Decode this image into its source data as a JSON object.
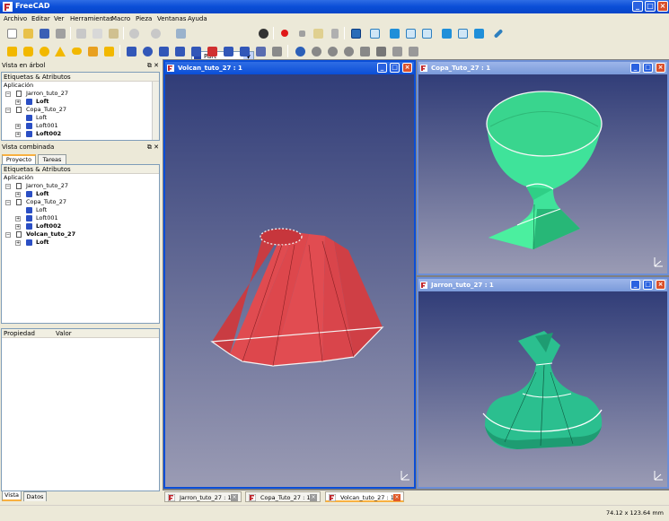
{
  "window": {
    "title": "FreeCAD"
  },
  "menu": [
    "Archivo",
    "Editar",
    "Ver",
    "Herramientas",
    "Macro",
    "Pieza",
    "Ventanas",
    "Ayuda"
  ],
  "workbench": {
    "selected": "Part"
  },
  "tree_dock": {
    "title": "Vista en árbol",
    "header": "Etiquetas & Atributos",
    "root": "Aplicación",
    "items": [
      {
        "label": "Jarron_tuto_27",
        "kind": "doc",
        "bold": false
      },
      {
        "label": "Loft",
        "kind": "part",
        "bold": true
      },
      {
        "label": "Copa_Tuto_27",
        "kind": "doc",
        "bold": false
      },
      {
        "label": "Loft",
        "kind": "part",
        "bold": false
      },
      {
        "label": "Loft001",
        "kind": "part",
        "bold": false
      },
      {
        "label": "Loft002",
        "kind": "part",
        "bold": true
      }
    ]
  },
  "combo_dock": {
    "title": "Vista combinada",
    "tabs": [
      "Proyecto",
      "Tareas"
    ],
    "header": "Etiquetas & Atributos",
    "root": "Aplicación",
    "items": [
      {
        "label": "Jarron_tuto_27",
        "kind": "doc",
        "bold": false
      },
      {
        "label": "Loft",
        "kind": "part",
        "bold": true
      },
      {
        "label": "Copa_Tuto_27",
        "kind": "doc",
        "bold": false
      },
      {
        "label": "Loft",
        "kind": "part",
        "bold": false
      },
      {
        "label": "Loft001",
        "kind": "part",
        "bold": false
      },
      {
        "label": "Loft002",
        "kind": "part",
        "bold": true
      },
      {
        "label": "Volcan_tuto_27",
        "kind": "doc",
        "bold": true
      },
      {
        "label": "Loft",
        "kind": "part",
        "bold": true
      }
    ],
    "property_columns": [
      "Propiedad",
      "Valor"
    ],
    "bottom_tabs": [
      "Vista",
      "Datos"
    ]
  },
  "windows": {
    "volcan": {
      "title": "Volcan_tuto_27 : 1"
    },
    "copa": {
      "title": "Copa_Tuto_27 : 1"
    },
    "jarron": {
      "title": "Jarron_tuto_27 : 1"
    }
  },
  "doc_tabs": [
    {
      "label": "Jarron_tuto_27 : 1",
      "active": false
    },
    {
      "label": "Copa_Tuto_27 : 1",
      "active": false
    },
    {
      "label": "Volcan_tuto_27 : 1",
      "active": true
    }
  ],
  "status": {
    "dimensions": "74.12 x 123.64 mm"
  },
  "colors": {
    "volcan": "#e04b50",
    "green": "#3fe39a",
    "teal": "#2bbf8f",
    "title_blue": "#0a4ed7"
  }
}
